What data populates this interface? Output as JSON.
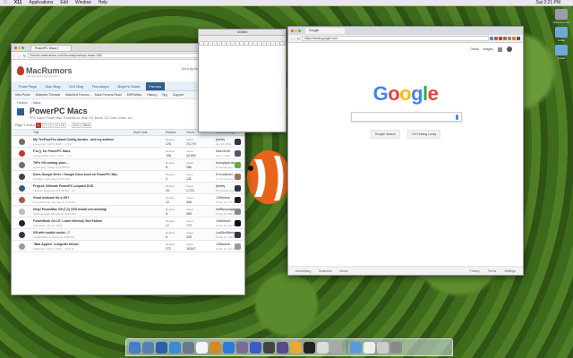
{
  "menubar": {
    "apple": "",
    "app": "X11",
    "items": [
      "Applications",
      "Edit",
      "Window",
      "Help"
    ],
    "clock": "Sat 2:21 PM"
  },
  "macrumors": {
    "tab_title": "PowerPC Macs | MacRumors",
    "url": "forums.macrumors.com/forums/powerpc-macs.145/",
    "brand": "MacRumors",
    "tagline": "news and rumors you care about",
    "login_prompt": "Got a tip for us?",
    "login_link": "Log in / Sign up",
    "nav": [
      "Front Page",
      "Mac Blog",
      "iOS Blog",
      "Roundups",
      "Buyer's Guide",
      "Forums"
    ],
    "nav_active": "Forums",
    "subnav": [
      "New Posts",
      "Watched Threads",
      "Watched Forums",
      "Mark Forums Read",
      "MRPolitics",
      "History",
      "Spy",
      "Support"
    ],
    "crumbs": [
      "Forums",
      "Macs"
    ],
    "forum_title": "PowerPC Macs",
    "forum_desc": "PPC Macs: Power Mac, PowerBook, iMac G4, iBook, G4 Cube, eMac, etc.",
    "pager_label": "Page 1 of 614",
    "pages": [
      "1",
      "2",
      "3",
      "4",
      "5",
      "…",
      "614",
      "Next"
    ],
    "columns": {
      "title": "Title",
      "start": "Start Date",
      "replies": "Replies",
      "views": "Views",
      "last": "Last Message ↓"
    },
    "threads": [
      {
        "title": "My TenFourFox about:Config tweaks - and my addons",
        "meta": "eyoungren, Jan 5, 2015 ... 4 5 6",
        "replies": "176",
        "views": "73,779",
        "last_user": "jbarley",
        "last_time": "Jan 22, 2016",
        "avatar": "#7a6a5a",
        "lav": "#334"
      },
      {
        "title": "F.A.Q. for PowerPC Macs",
        "meta": "netmaster95, Mar 2, 2012 ... 2 3",
        "replies": "158",
        "views": "43,650",
        "last_user": "Mac15h90",
        "last_time": "Sep 2, 2015",
        "avatar": "#c0392b",
        "lav": "#556"
      },
      {
        "title": "Tiff's G5 coming soon...",
        "meta": "eyoungren, Today at 12:08 PM",
        "replies": "8",
        "views": "186",
        "last_user": "bunnyspecial",
        "last_time": "5 minutes ago",
        "avatar": "#7a6a5a",
        "lav": "#6a4"
      },
      {
        "title": "Does Google Drive / Google Docs work on PowerPC Mac",
        "meta": "NotStan, Yesterday at 5:54 PM",
        "replies": "3",
        "views": "131",
        "last_user": "Droncatcher",
        "last_time": "17 minutes ago",
        "avatar": "#444",
        "lav": "#975"
      },
      {
        "title": "Project: Ultimate PowerPC Leopard DVD",
        "meta": "Intbrew, Yesterday at 4:46 PM ... 2",
        "replies": "34",
        "views": "1,714",
        "last_user": "jbarley",
        "last_time": "28 minutes ago",
        "avatar": "#3a5a80",
        "lav": "#334"
      },
      {
        "title": "Good webcam for a G5?",
        "meta": "PowerMacFan, Monday at 6:18 PM",
        "replies": "12",
        "views": "368",
        "last_user": "128keaton",
        "last_time": "Today at 2:15 PM",
        "avatar": "#a55",
        "lav": "#222"
      },
      {
        "title": "Help! PowerMac G5 (7,2) OSX install not working!",
        "meta": "heftikusmagik, Monday at 11:46 PM",
        "replies": "8",
        "views": "455",
        "last_user": "heftikusmagik",
        "last_time": "Today at 2:09 PM",
        "avatar": "#bbb",
        "lav": "#888"
      },
      {
        "title": "PowerBook G4 15\" Lower Memory Slot Failure",
        "meta": "blackbitch, Jan 21, 2016",
        "replies": "17",
        "views": "772",
        "last_user": "1rabbeach",
        "last_time": "Today at 1:38 PM",
        "avatar": "#222",
        "lav": "#111"
      },
      {
        "title": "G5 with mobile router...?",
        "meta": "LudDkzWanna, Today at 10:55 AM",
        "replies": "6",
        "views": "125",
        "last_user": "LudDkzWanna",
        "last_time": "Today at 1:25 PM",
        "avatar": "#334",
        "lav": "#334"
      },
      {
        "title": "\"Bad Apples\" craigslist thread.",
        "meta": "128keaton, Dec 5, 2014 ... 9 10 11",
        "replies": "272",
        "views": "18,847",
        "last_user": "128keaton",
        "last_time": "Today at 1:20 PM",
        "avatar": "#999",
        "lav": "#999"
      }
    ]
  },
  "textedit": {
    "title": "Untitled"
  },
  "chrome": {
    "tab_title": "Google",
    "url": "https://www.google.com",
    "top_links": [
      "Gmail",
      "Images"
    ],
    "logo": [
      "G",
      "o",
      "o",
      "g",
      "l",
      "e"
    ],
    "logo_colors": [
      "#4285f4",
      "#ea4335",
      "#fbbc05",
      "#4285f4",
      "#34a853",
      "#ea4335"
    ],
    "buttons": [
      "Google Search",
      "I'm Feeling Lucky"
    ],
    "footer_left": [
      "Advertising",
      "Business",
      "About"
    ],
    "footer_right": [
      "Privacy",
      "Terms",
      "Settings"
    ]
  },
  "desktop": {
    "icons": [
      "Macintosh HD",
      "Folder",
      "Folder"
    ]
  }
}
